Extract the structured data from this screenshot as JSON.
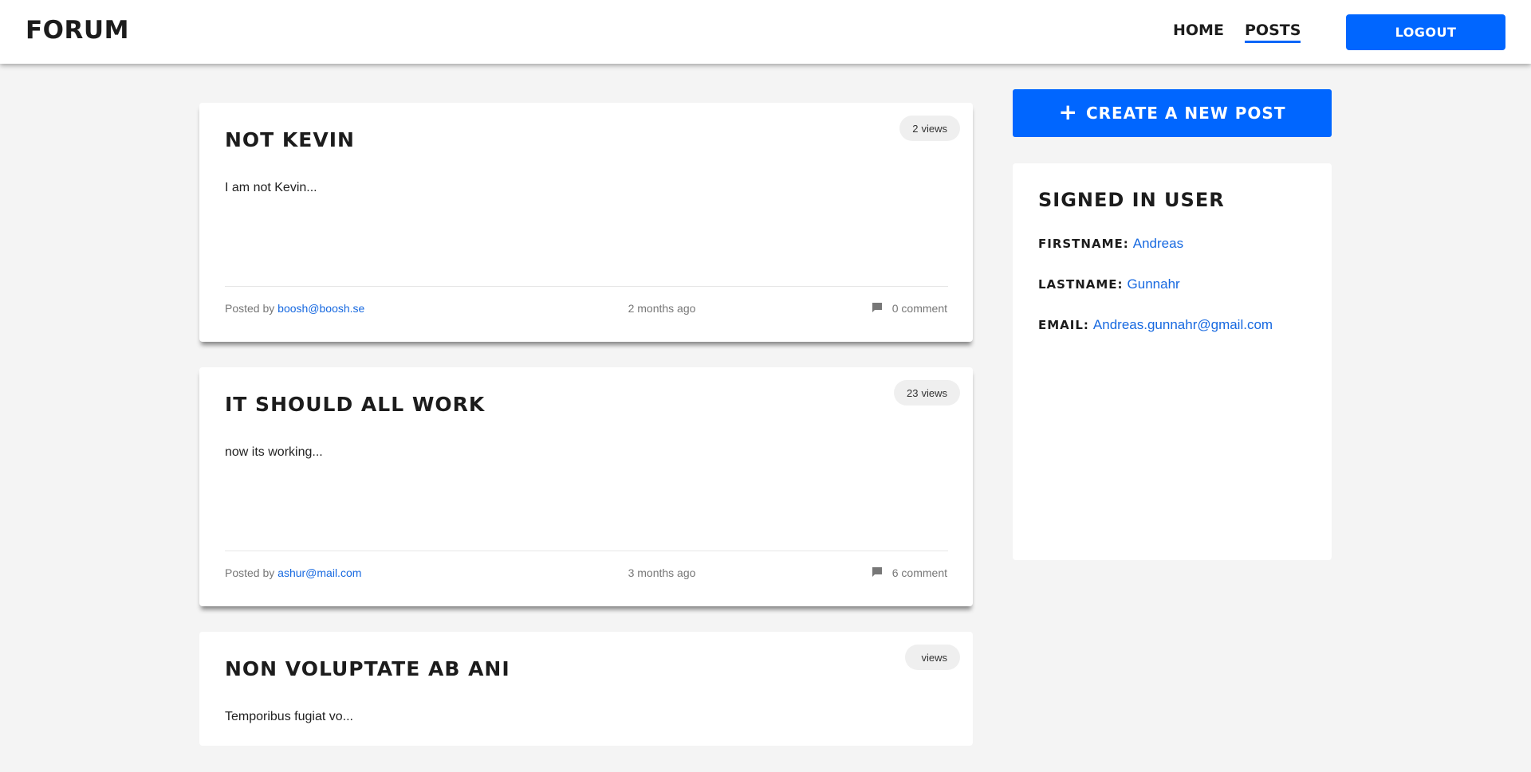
{
  "header": {
    "logo": "FORUM",
    "nav": {
      "home": "HOME",
      "posts": "POSTS"
    },
    "logout_label": "LOGOUT"
  },
  "colors": {
    "accent": "#0066ff",
    "link": "#1769e0"
  },
  "posts": [
    {
      "title": "NOT KEVIN",
      "views_count": "2",
      "views_label": "views",
      "excerpt": "I am not Kevin...",
      "posted_by_label": "Posted by",
      "author": "boosh@boosh.se",
      "time": "2 months ago",
      "comments": "0 comment"
    },
    {
      "title": "IT SHOULD ALL WORK",
      "views_count": "23",
      "views_label": "views",
      "excerpt": "now its working...",
      "posted_by_label": "Posted by",
      "author": "ashur@mail.com",
      "time": "3 months ago",
      "comments": "6 comment"
    },
    {
      "title": "NON VOLUPTATE AB ANI",
      "views_count": "",
      "views_label": "views",
      "excerpt": "Temporibus fugiat vo..."
    }
  ],
  "sidebar": {
    "create_label": "CREATE A NEW POST",
    "plus_icon": "+",
    "user": {
      "title": "SIGNED IN USER",
      "firstname_label": "FIRSTNAME:",
      "firstname": "Andreas",
      "lastname_label": "LASTNAME:",
      "lastname": "Gunnahr",
      "email_label": "EMAIL:",
      "email": "Andreas.gunnahr@gmail.com"
    }
  },
  "icons": {
    "comment": "comment-icon",
    "plus": "plus-icon"
  }
}
